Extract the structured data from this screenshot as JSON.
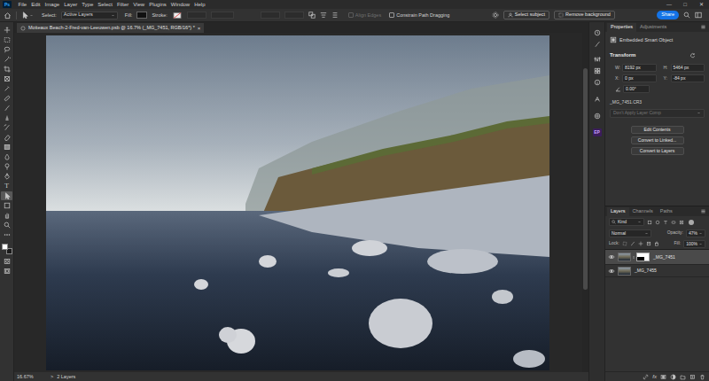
{
  "app": {
    "logo": "Ps",
    "window_controls": [
      "—",
      "□",
      "✕"
    ]
  },
  "menu": [
    "File",
    "Edit",
    "Image",
    "Layer",
    "Type",
    "Select",
    "Filter",
    "View",
    "Plugins",
    "Window",
    "Help"
  ],
  "options_bar": {
    "select_label": "Select:",
    "select_value": "Active Layers",
    "fill_label": "Fill:",
    "stroke_label": "Stroke:",
    "align_edges": {
      "label": "Align Edges",
      "disabled": true
    },
    "constrain": {
      "label": "Constrain Path Dragging",
      "checked": false
    },
    "select_subject": "Select subject",
    "remove_background": "Remove background",
    "share": "Share"
  },
  "document_tab": {
    "title": "Moiteaux Beach-2-Fred-van-Leeuwen.psb @ 16.7% (_MG_7451, RGB/16*) *",
    "close": "×",
    "selected": true
  },
  "toolbar": {
    "tools": [
      {
        "selected": false
      },
      {
        "selected": false
      },
      {
        "selected": false
      },
      {
        "selected": false
      },
      {
        "selected": false
      },
      {
        "selected": false
      },
      {
        "selected": false
      },
      {
        "selected": false
      },
      {
        "selected": false
      },
      {
        "selected": false
      },
      {
        "selected": false
      },
      {
        "selected": false
      },
      {
        "selected": false
      },
      {
        "selected": false
      },
      {
        "selected": false
      },
      {
        "selected": false
      },
      {
        "selected": false,
        "glyph": "T"
      },
      {
        "selected": true
      },
      {
        "selected": false
      },
      {
        "selected": false
      },
      {
        "selected": false
      },
      {
        "selected": false
      }
    ],
    "foreground_color": "#ffffff",
    "background_color": "#1a1a1a"
  },
  "side_icons": {
    "plugin_badge": "EP"
  },
  "properties": {
    "tabs": [
      {
        "label": "Properties",
        "selected": true
      },
      {
        "label": "Adjustments",
        "selected": false
      }
    ],
    "type": "Embedded Smart Object",
    "section": "Transform",
    "w_label": "W:",
    "w": "8192 px",
    "h_label": "H:",
    "h": "5464 px",
    "x_label": "X:",
    "x": "0 px",
    "y_label": "Y:",
    "y": "-84 px",
    "angle": "0.00°",
    "file": "_MG_7451.CR3",
    "layer_comp": {
      "label": "Don't Apply Layer Comp",
      "disabled": true
    },
    "buttons": [
      "Edit Contents",
      "Convert to Linked...",
      "Convert to Layers"
    ]
  },
  "layers_panel": {
    "tabs": [
      {
        "label": "Layers",
        "selected": true
      },
      {
        "label": "Channels",
        "selected": false
      },
      {
        "label": "Paths",
        "selected": false
      }
    ],
    "filter": "Kind",
    "blend_mode": "Normal",
    "opacity_label": "Opacity:",
    "opacity": "47%",
    "lock_label": "Lock:",
    "fill_label": "Fill:",
    "fill": "100%",
    "layers": [
      {
        "name": "_MG_7451",
        "visible": true,
        "selected": true,
        "has_mask": true
      },
      {
        "name": "_MG_7455",
        "visible": true,
        "selected": false,
        "has_mask": false
      }
    ],
    "footer_fx": "fx"
  },
  "status_bar": {
    "zoom": "16.67%",
    "arrow": ">",
    "info": "2 Layers"
  }
}
